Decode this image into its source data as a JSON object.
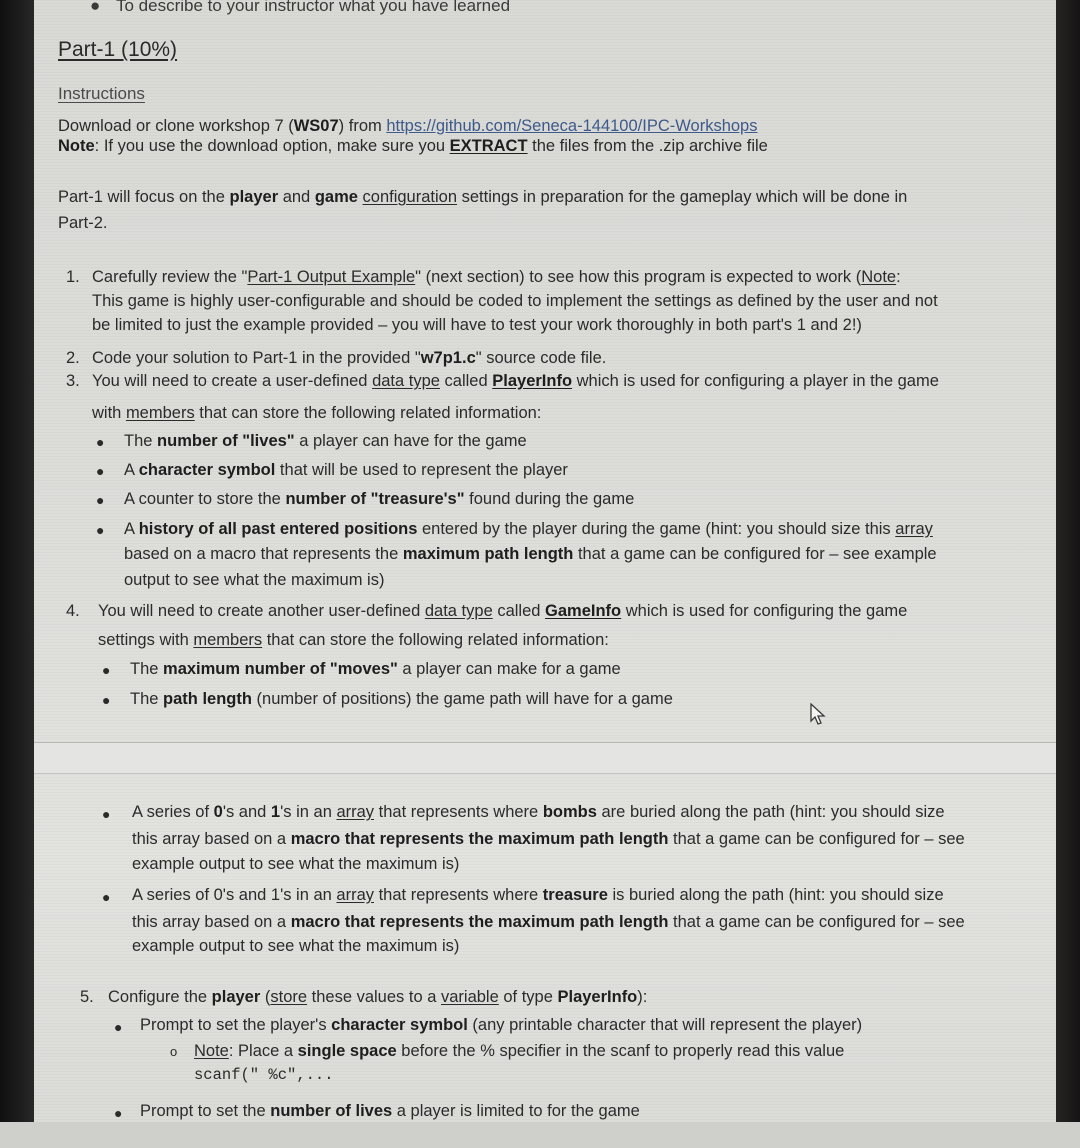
{
  "prev_section_bullet": "To describe to your instructor what you have learned",
  "part_title": "Part-1 (10%)",
  "instructions_heading": "Instructions",
  "intro": {
    "download_prefix": "Download or clone workshop 7 (",
    "workshop_code": "WS07",
    "download_mid": ") from ",
    "repo_link": "https://github.com/Seneca-144100/IPC-Workshops",
    "note_label": "Note",
    "note_prefix": ": If you use the download option, make sure you ",
    "note_emphasis": "EXTRACT",
    "note_suffix": " the files from the .zip archive file"
  },
  "focus_paragraph": {
    "p1": "Part-1 will focus on the ",
    "player": "player",
    "p2": " and ",
    "game": "game",
    "p3": " ",
    "configuration": "configuration",
    "p4": " settings in preparation for the gameplay which will be done in",
    "line2": "Part-2."
  },
  "steps": [
    {
      "number": "1.",
      "l1_a": "Carefully review the \"",
      "l1_link": "Part-1 Output Example",
      "l1_b": "\" (next section) to see how this program is expected to work (",
      "l1_note": "Note",
      "l1_c": ":",
      "l2": "This game is highly user-configurable and should be coded to implement the settings as defined by the user and not",
      "l3": "be limited to just the example provided – you will have to test your work thoroughly in both part's 1 and 2!)"
    },
    {
      "number": "2.",
      "a": "Code your solution to Part-1 in the provided \"",
      "file": "w7p1.c",
      "b": "\" source code file."
    },
    {
      "number": "3.",
      "a": "You will need to create a user-defined ",
      "data_type": "data type",
      "b": " called ",
      "type_name": "PlayerInfo",
      "c": " which is used for configuring a player in the game",
      "l2_a": "with ",
      "members": "members",
      "l2_b": " that can store the following related information:",
      "bullets": [
        {
          "pre": "The ",
          "bold": "number of \"lives\"",
          "post": " a player can have for the game"
        },
        {
          "pre": "A ",
          "bold": "character symbol",
          "post": " that will be used to represent the player"
        },
        {
          "pre": "A counter to store the ",
          "bold": "number of \"treasure's\"",
          "post": " found during the game"
        },
        {
          "pre": "A ",
          "bold": "history of all past entered positions",
          "post": " entered by the player during the game (hint: you should size this ",
          "array": "array",
          "l2_pre": "based on a macro that represents the ",
          "l2_bold": "maximum path length",
          "l2_post": " that a game can be configured for – see example",
          "l3": "output to see what the maximum is)"
        }
      ]
    },
    {
      "number": "4.",
      "a": "You will need to create another user-defined ",
      "data_type": "data type",
      "b": " called ",
      "type_name": "GameInfo",
      "c": " which is used for configuring the game",
      "l2_a": "settings with ",
      "members": "members",
      "l2_b": " that can store the following related information:",
      "bullets": [
        {
          "pre": "The ",
          "bold": "maximum number of \"moves\"",
          "post": " a player can make for a game"
        },
        {
          "pre": "The ",
          "bold": "path length",
          "post": " (number of positions) the game path will have for a game"
        },
        {
          "pre": "A series of ",
          "bold0": "0",
          "mid0": "'s and ",
          "bold1": "1",
          "mid1": "'s in an ",
          "array": "array",
          "post_a": " that represents where ",
          "bold": "bombs",
          "post": " are buried along the path (hint: you should size",
          "l2_pre": "this array based on a ",
          "l2_bold": "macro that represents the maximum path length",
          "l2_post": " that a game can be configured for – see",
          "l3": "example output to see what the maximum is)"
        },
        {
          "pre": "A series of 0's and 1's in an ",
          "array": "array",
          "post_a": " that represents where ",
          "bold": "treasure",
          "post": " is buried along the path (hint: you should size",
          "l2_pre": "this array based on a ",
          "l2_bold": "macro that represents the maximum path length",
          "l2_post": " that a game can be configured for – see",
          "l3": "example output to see what the maximum is)"
        }
      ]
    },
    {
      "number": "5.",
      "a": "Configure the ",
      "player": "player",
      "b": " (",
      "store": "store",
      "c": " these values to a ",
      "variable": "variable",
      "d": " of type ",
      "type_name": "PlayerInfo",
      "e": "):",
      "bullets": [
        {
          "pre": "Prompt to set the player's ",
          "bold": "character symbol",
          "post": " (any printable character that will represent the player)",
          "sub": {
            "marker": "o",
            "note": "Note",
            "pre": ": Place a ",
            "bold": "single space",
            "post": " before the % specifier in the scanf to properly read this value",
            "code": "scanf(\" %c\",..."
          }
        },
        {
          "pre": "Prompt to set the ",
          "bold": "number of lives",
          "post": " a player is limited to for the game"
        }
      ]
    }
  ]
}
